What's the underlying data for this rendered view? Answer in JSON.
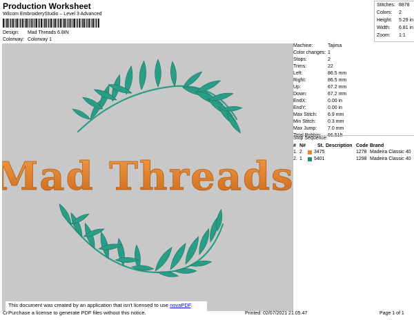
{
  "header": {
    "title": "Production Worksheet",
    "software": "Wilcom EmbroideryStudio – Level 3 Advanced",
    "design_label": "Design:",
    "design_value": "Mad Threads 6.8IN",
    "colorway_label": "Colorway:",
    "colorway_value": "Colorway 1"
  },
  "summary": {
    "stitches_label": "Stitches:",
    "stitches_value": "8878",
    "colors_label": "Colors:",
    "colors_value": "2",
    "height_label": "Height:",
    "height_value": "5.29 in",
    "width_label": "Width:",
    "width_value": "6.81 in",
    "zoom_label": "Zoom:",
    "zoom_value": "1:1"
  },
  "design": {
    "text": "Mad Threads",
    "text_color": "#e8852f",
    "leaf_color": "#2a9d86",
    "background": "#c8c8c8"
  },
  "machine_info": [
    {
      "label": "Machine:",
      "value": "Tajima"
    },
    {
      "label": "Color changes:",
      "value": "1"
    },
    {
      "label": "Stops:",
      "value": "2"
    },
    {
      "label": "Trims:",
      "value": "22"
    },
    {
      "label": "Left:",
      "value": "86.5 mm"
    },
    {
      "label": "Right:",
      "value": "86.5 mm"
    },
    {
      "label": "Up:",
      "value": "67.2 mm"
    },
    {
      "label": "Down:",
      "value": "67.2 mm"
    },
    {
      "label": "EndX:",
      "value": "0.00 in"
    },
    {
      "label": "EndY:",
      "value": "0.00 in"
    },
    {
      "label": "Max Stitch:",
      "value": "6.9 mm"
    },
    {
      "label": "Min Stitch:",
      "value": "0.3 mm"
    },
    {
      "label": "Max Jump:",
      "value": "7.0 mm"
    },
    {
      "label": "Total Bobbin:",
      "value": "66.51ft"
    }
  ],
  "stop_sequence": {
    "title": "Stop Sequence:",
    "columns": [
      "#",
      "N#",
      "St.",
      "Description",
      "Code",
      "Brand"
    ],
    "rows": [
      {
        "num": "1.",
        "n": "2",
        "color": "#e8852f",
        "st": "3475",
        "code": "1278",
        "brand": "Madeira Classic 40"
      },
      {
        "num": "2.",
        "n": "1",
        "color": "#1f8b7c",
        "st": "5401",
        "code": "1298",
        "brand": "Madeira Classic 40"
      }
    ]
  },
  "notice": {
    "line1_prefix": "This document was created by an application that isn't licensed to use ",
    "link": "novaPDF",
    "line1_suffix": ".",
    "line2": "Purchase a license to generate PDF files without this notice."
  },
  "footer": {
    "left": "Cr",
    "printed": "Printed: 02/07/2021 21.05.47",
    "page": "Page 1 of 1"
  }
}
